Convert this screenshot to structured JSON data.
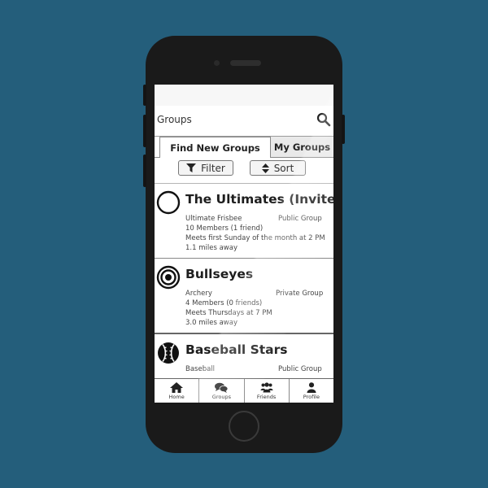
{
  "search": {
    "label": "Groups",
    "icon": "search-icon"
  },
  "tabs": [
    {
      "label": "Find New Groups",
      "active": true
    },
    {
      "label": "My Groups",
      "active": false
    }
  ],
  "controls": {
    "filter": {
      "label": "Filter",
      "icon": "filter-icon"
    },
    "sort": {
      "label": "Sort",
      "icon": "sort-icon"
    }
  },
  "groups": [
    {
      "title": "The Ultimates (Invited)",
      "icon": "circle-outline-icon",
      "sport": "Ultimate Frisbee",
      "privacy": "Public Group",
      "members": "10 Members (1 friend)",
      "schedule": "Meets first Sunday of the month at 2 PM",
      "distance": "1.1 miles away"
    },
    {
      "title": "Bullseyes",
      "icon": "target-icon",
      "sport": "Archery",
      "privacy": "Private Group",
      "members": "4 Members (0 friends)",
      "schedule": "Meets Thursdays at 7 PM",
      "distance": "3.0 miles away"
    },
    {
      "title": "Baseball Stars",
      "icon": "baseball-icon",
      "sport": "Baseball",
      "privacy": "Public Group"
    }
  ],
  "nav": [
    {
      "label": "Home",
      "icon": "home-icon"
    },
    {
      "label": "Groups",
      "icon": "chat-bubbles-icon"
    },
    {
      "label": "Friends",
      "icon": "friends-icon"
    },
    {
      "label": "Profile",
      "icon": "user-icon"
    }
  ],
  "colors": {
    "background": "#245e7b",
    "phone_body": "#1a1a1a",
    "screen": "#ffffff"
  }
}
